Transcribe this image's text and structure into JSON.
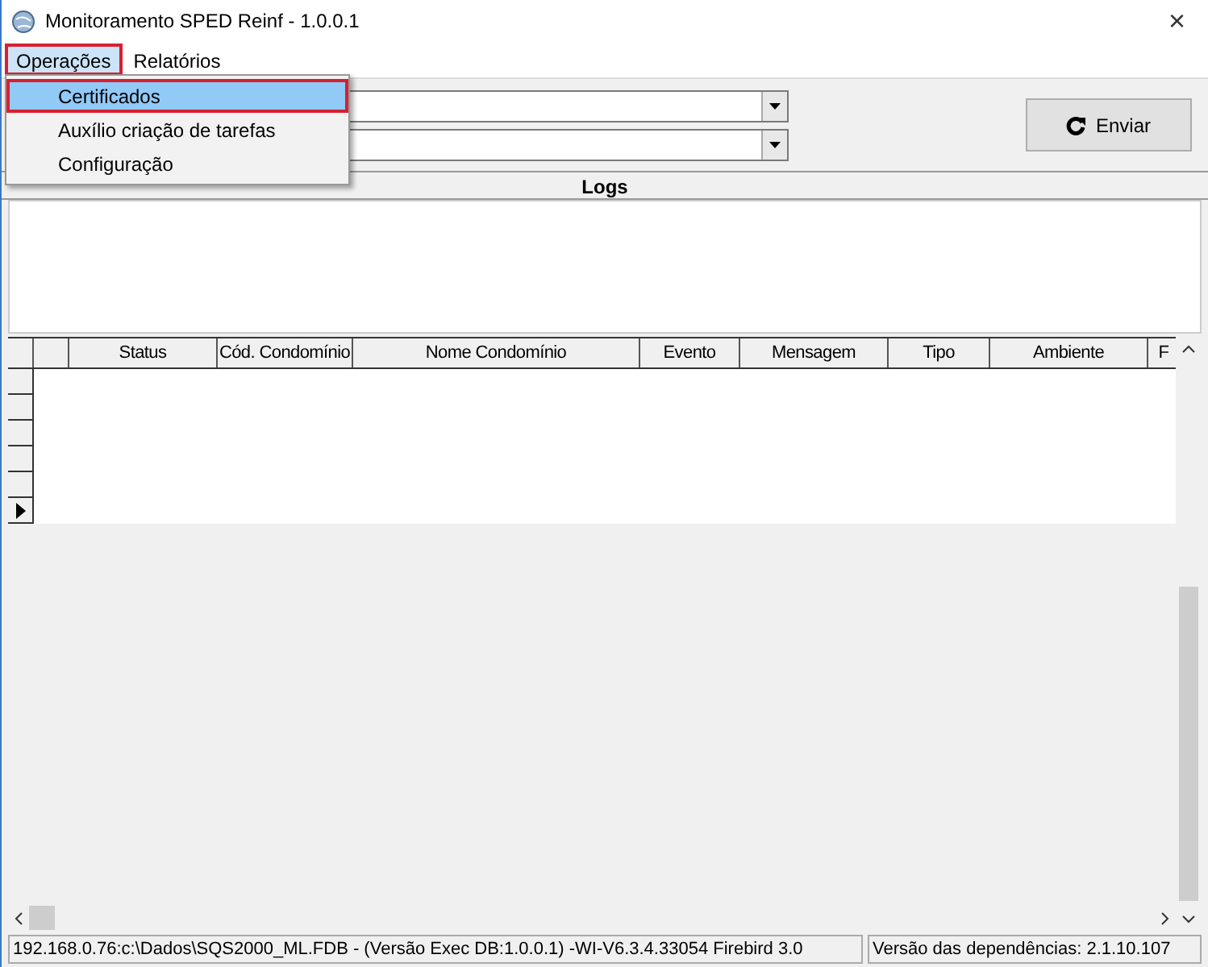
{
  "window": {
    "title": "Monitoramento SPED Reinf - 1.0.0.1",
    "close": "×"
  },
  "menu_bar": [
    {
      "label": "Operações",
      "open": true
    },
    {
      "label": "Relatórios",
      "open": false
    }
  ],
  "dropdown": [
    {
      "label": "Certificados",
      "selected": true
    },
    {
      "label": "Auxílio criação de tarefas",
      "selected": false
    },
    {
      "label": "Configuração",
      "selected": false
    }
  ],
  "send_button": {
    "label": "Enviar"
  },
  "logs": {
    "title": "Logs"
  },
  "grid": {
    "columns": [
      "Status",
      "Cód. Condomínio",
      "Nome Condomínio",
      "Evento",
      "Mensagem",
      "Tipo",
      "Ambiente",
      "F"
    ],
    "rows": [
      {
        "current": false
      },
      {
        "current": false
      },
      {
        "current": false
      },
      {
        "current": false
      },
      {
        "current": false
      },
      {
        "current": true
      }
    ]
  },
  "status_bar": [
    "192.168.0.76:c:\\Dados\\SQS2000_ML.FDB - (Versão Exec DB:1.0.0.1) -WI-V6.3.4.33054 Firebird 3.0",
    "Versão das dependências: 2.1.10.107"
  ]
}
